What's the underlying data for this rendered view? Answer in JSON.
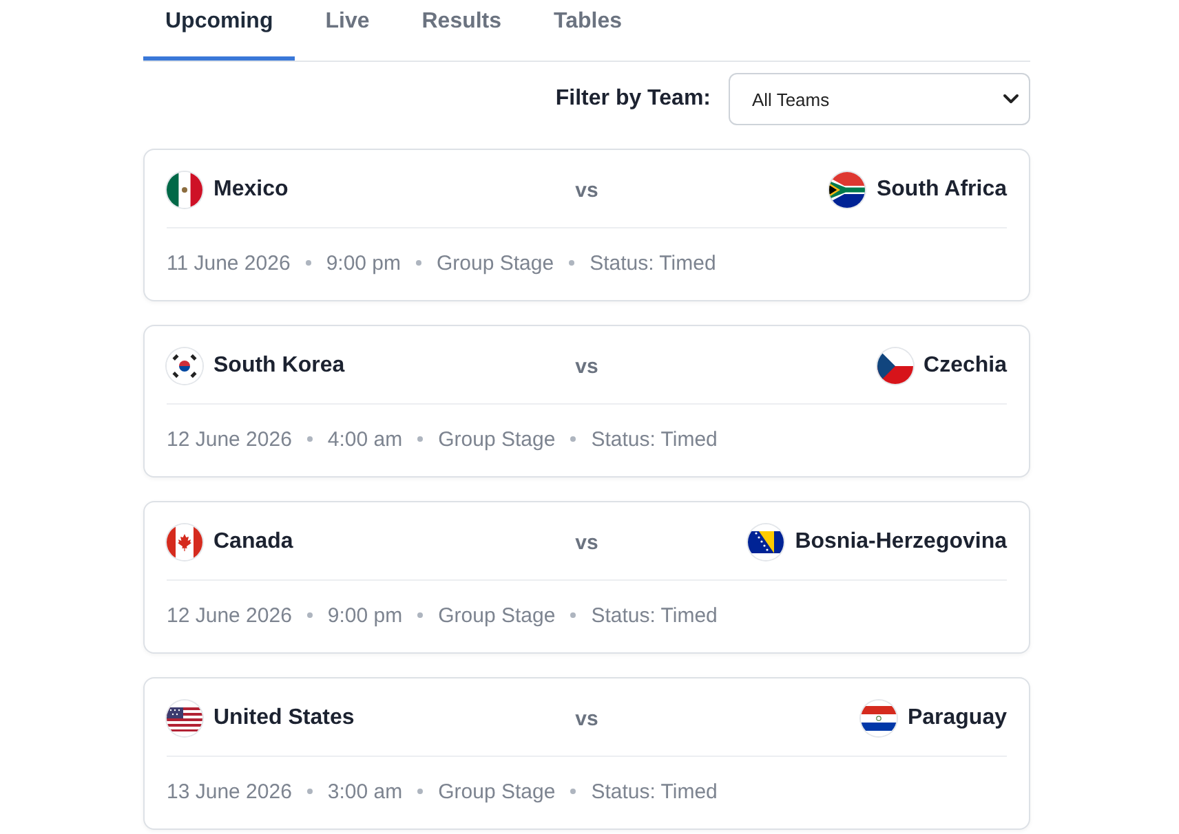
{
  "tabs": [
    {
      "label": "Upcoming",
      "selected": true
    },
    {
      "label": "Live",
      "selected": false
    },
    {
      "label": "Results",
      "selected": false
    },
    {
      "label": "Tables",
      "selected": false
    }
  ],
  "filter": {
    "label": "Filter by Team:",
    "value": "All Teams"
  },
  "matches": [
    {
      "home": "Mexico",
      "separator": "vs",
      "away": "South Africa",
      "date": "11 June 2026",
      "time": "9:00 pm",
      "stage": "Group Stage",
      "status": "Status: Timed"
    },
    {
      "home": "South Korea",
      "separator": "vs",
      "away": "Czechia",
      "date": "12 June 2026",
      "time": "4:00 am",
      "stage": "Group Stage",
      "status": "Status: Timed"
    },
    {
      "home": "Canada",
      "separator": "vs",
      "away": "Bosnia-Herzegovina",
      "date": "12 June 2026",
      "time": "9:00 pm",
      "stage": "Group Stage",
      "status": "Status: Timed"
    },
    {
      "home": "United States",
      "separator": "vs",
      "away": "Paraguay",
      "date": "13 June 2026",
      "time": "3:00 am",
      "stage": "Group Stage",
      "status": "Status: Timed"
    }
  ]
}
